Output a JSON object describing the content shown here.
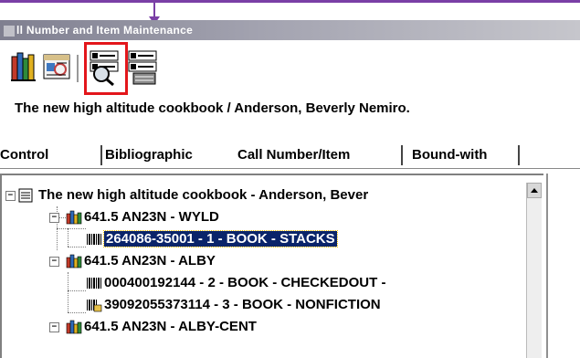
{
  "window": {
    "title": "ll Number and Item Maintenance"
  },
  "toolbar": {
    "icons": [
      "books-icon",
      "catalog-record-icon",
      "item-search-icon",
      "item-record-icon"
    ],
    "highlighted": "item-search-icon"
  },
  "record_title": "The new high altitude cookbook / Anderson, Beverly Nemiro.",
  "tabs": [
    {
      "label": "Control"
    },
    {
      "label": "Bibliographic"
    },
    {
      "label": "Call Number/Item"
    },
    {
      "label": "Bound-with"
    }
  ],
  "active_tab": "Call Number/Item",
  "tree": {
    "root": "The new high altitude cookbook - Anderson, Bever",
    "call_numbers": [
      {
        "label": "641.5 AN23N - WYLD",
        "items": [
          {
            "label": "264086-35001 - 1 - BOOK - STACKS",
            "selected": true
          }
        ]
      },
      {
        "label": "641.5 AN23N - ALBY",
        "items": [
          {
            "label": "000400192144 - 2 - BOOK - CHECKEDOUT -",
            "selected": false
          },
          {
            "label": "39092055373114 - 3 - BOOK - NONFICTION",
            "selected": false
          }
        ]
      },
      {
        "label": "641.5 AN23N - ALBY-CENT",
        "items": []
      }
    ]
  },
  "colors": {
    "accent_purple": "#7a3fa6",
    "highlight_red": "#e3161b",
    "selection_bg": "#0a246a"
  }
}
